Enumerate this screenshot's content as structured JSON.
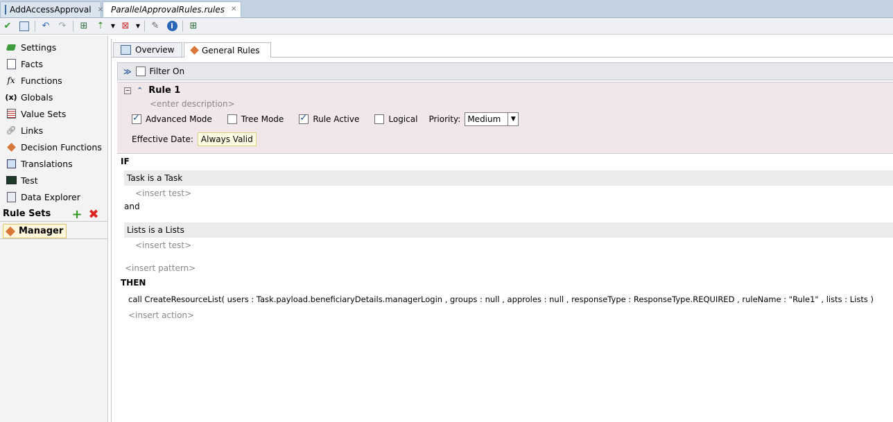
{
  "editor_tabs": [
    {
      "label": "AddAccessApproval"
    },
    {
      "label": "ParallelApprovalRules.rules"
    }
  ],
  "sidebar": {
    "items": [
      {
        "label": "Settings",
        "icon": "settings-icon"
      },
      {
        "label": "Facts",
        "icon": "facts-icon"
      },
      {
        "label": "Functions",
        "icon": "functions-icon",
        "glyph": "fx"
      },
      {
        "label": "Globals",
        "icon": "globals-icon",
        "glyph": "(x)"
      },
      {
        "label": "Value Sets",
        "icon": "value-sets-icon"
      },
      {
        "label": "Links",
        "icon": "links-icon"
      },
      {
        "label": "Decision Functions",
        "icon": "decision-functions-icon"
      },
      {
        "label": "Translations",
        "icon": "translations-icon"
      },
      {
        "label": "Test",
        "icon": "test-icon"
      },
      {
        "label": "Data Explorer",
        "icon": "data-explorer-icon"
      }
    ],
    "rule_sets_header": "Rule Sets",
    "rule_set": "Manager"
  },
  "sub_tabs": [
    {
      "label": "Overview"
    },
    {
      "label": "General Rules"
    }
  ],
  "filter": {
    "label": "Filter On",
    "checked": false
  },
  "rule": {
    "title": "Rule 1",
    "description_placeholder": "<enter description>",
    "options": [
      {
        "label": "Advanced Mode",
        "checked": true
      },
      {
        "label": "Tree Mode",
        "checked": false
      },
      {
        "label": "Rule Active",
        "checked": true
      },
      {
        "label": "Logical",
        "checked": false
      }
    ],
    "priority_label": "Priority:",
    "priority_value": "Medium",
    "effective_date_label": "Effective Date:",
    "effective_date_value": "Always Valid"
  },
  "conditions": {
    "if_label": "IF",
    "pattern1": "Task is a Task",
    "insert_test1": "<insert test>",
    "and_label": "and",
    "pattern2": "Lists is a Lists",
    "insert_test2": "<insert test>",
    "insert_pattern": "<insert pattern>"
  },
  "actions": {
    "then_label": "THEN",
    "action1": "call CreateResourceList( users : Task.payload.beneficiaryDetails.managerLogin , groups : null , approles : null , responseType : ResponseType.REQUIRED , ruleName : \"Rule1\" , lists : Lists )",
    "insert_action": "<insert action>"
  },
  "colors": {
    "tab_bar": "#c4d3e3",
    "rule_header_bg": "#f1e6ea",
    "pattern_band": "#ebebeb",
    "placeholder": "#888888",
    "add_green": "#2e9b1f",
    "delete_red": "#dd2222"
  }
}
